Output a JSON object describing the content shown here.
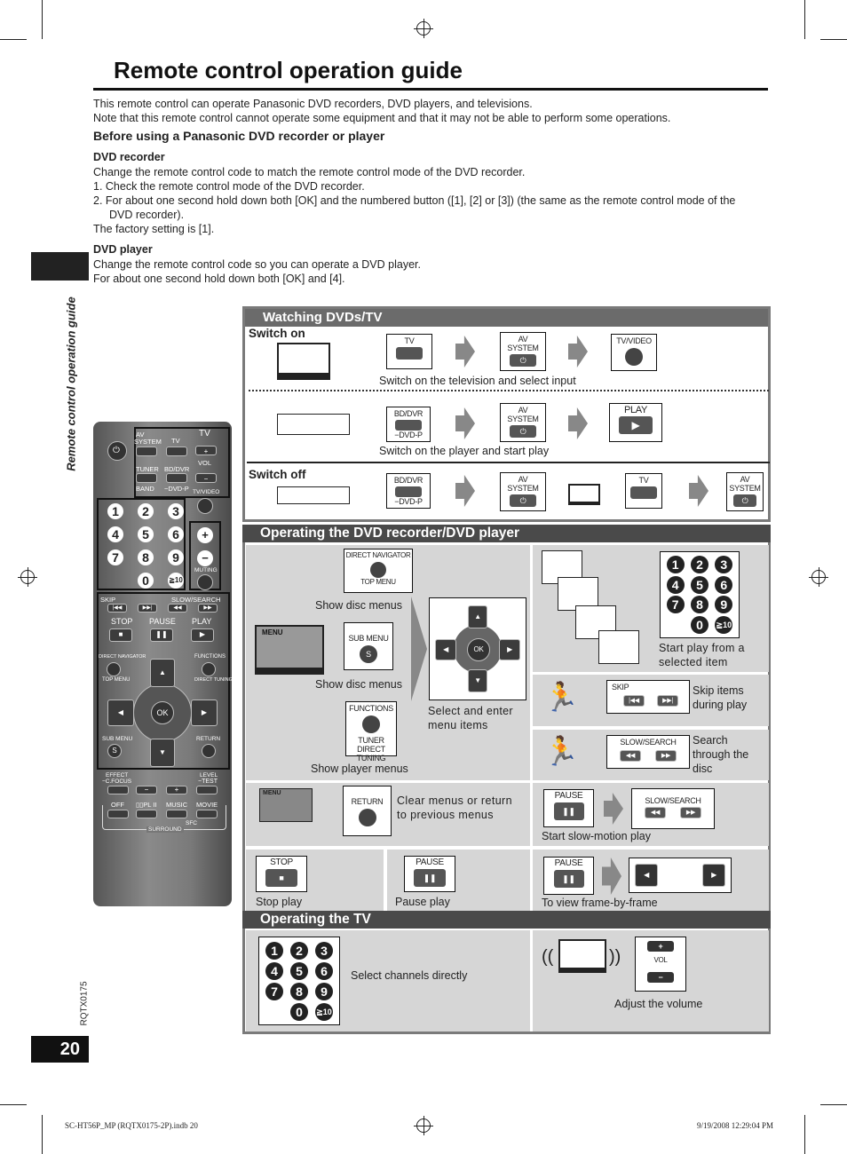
{
  "title": "Remote control operation guide",
  "intro": [
    "This remote control can operate Panasonic DVD recorders, DVD players, and televisions.",
    "Note that this remote control cannot operate some equipment and that it may not be able to perform some operations."
  ],
  "before_heading": "Before using a Panasonic DVD recorder or player",
  "recorder": {
    "heading": "DVD recorder",
    "lines": [
      "Change the remote control code to match the remote control mode of the DVD recorder.",
      "1.  Check the remote control mode of the DVD recorder.",
      "2.  For about one second hold down both [OK] and the numbered button ([1], [2] or [3]) (the same as the remote control mode of the",
      "     DVD recorder).",
      "The factory setting is [1]."
    ]
  },
  "player": {
    "heading": "DVD player",
    "lines": [
      "Change the remote control code so you can operate a DVD player.",
      "For about one second hold down both [OK] and [4]."
    ]
  },
  "side_label": "Remote control operation guide",
  "doc_code": "RQTX0175",
  "page_number": "20",
  "footer": {
    "left": "SC-HT56P_MP (RQTX0175-2P).indb   20",
    "right": "9/19/2008   12:29:04 PM"
  },
  "colors": {
    "section_header": "#4a4a4a",
    "watching_header": "#6b6b6b",
    "cell_bg": "#d6d6d6"
  },
  "keys": {
    "tv": "TV",
    "av": "AV",
    "system": "SYSTEM",
    "power": "⏻",
    "tvvideo": "TV/VIDEO",
    "bddvr": "BD/DVR",
    "dvdp": "−DVD-P",
    "play": "PLAY",
    "play_sym": "▶",
    "direct_nav": "DIRECT NAVIGATOR",
    "top_menu": "TOP MENU",
    "sub_menu": "SUB MENU",
    "s": "S",
    "functions": "FUNCTIONS",
    "tuner": "TUNER",
    "direct_tuning": "DIRECT TUNING",
    "ok": "OK",
    "skip": "SKIP",
    "slow_search": "SLOW/SEARCH",
    "return": "RETURN",
    "pause": "PAUSE",
    "stop": "STOP",
    "vol": "VOL",
    "plus": "+",
    "minus": "−",
    "menu": "MENU",
    "rew": "◀◀",
    "ff": "▶▶",
    "prev": "|◀◀",
    "next": "▶▶|",
    "pause_sym": "❚❚",
    "stop_sym": "■",
    "up": "▲",
    "down": "▼",
    "left": "◀",
    "right": "▶"
  },
  "watching": {
    "header": "Watching DVDs/TV",
    "switch_on": "Switch on",
    "cap1": "Switch on the television and select input",
    "cap2": "Switch on the player and start play",
    "switch_off": "Switch off"
  },
  "operating": {
    "header": "Operating the DVD recorder/DVD player",
    "show_disc_menus": "Show disc menus",
    "show_player_menus": "Show player menus",
    "select_enter": "Select and enter menu items",
    "start_play": "Start play from a selected item",
    "skip_items": "Skip items during play",
    "search": "Search through the disc",
    "clear_menus": "Clear menus or return to  previous menus",
    "slow_motion": "Start slow-motion play",
    "stop_play": "Stop play",
    "pause_play": "Pause play",
    "frame": "To view frame-by-frame"
  },
  "tv": {
    "header": "Operating the TV",
    "select_channels": "Select channels directly",
    "adjust_volume": "Adjust the volume"
  },
  "numpad": [
    "1",
    "2",
    "3",
    "4",
    "5",
    "6",
    "7",
    "8",
    "9",
    "",
    "0",
    "≧10"
  ],
  "remote": {
    "tuner": "TUNER",
    "band": "BAND",
    "muting": "MUTING",
    "effect": "EFFECT",
    "cfocus": "−C.FOCUS",
    "level": "LEVEL",
    "test": "−TEST",
    "off": "OFF",
    "plii": "▯▯PL II",
    "music": "MUSIC",
    "movie": "MOVIE",
    "sfc": "SFC",
    "surround": "SURROUND"
  }
}
